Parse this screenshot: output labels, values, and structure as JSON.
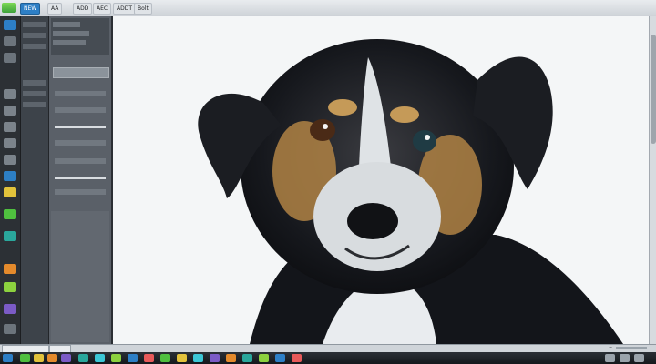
{
  "menubar": {
    "items": [
      "NEW",
      "AA",
      "ADD",
      "AEC",
      "ADDT",
      "Bolt"
    ]
  },
  "status": {
    "zoom_label": "−"
  },
  "colors": {
    "accent": "#2d7fc6",
    "canvas_bg": "#f4f6f7"
  }
}
